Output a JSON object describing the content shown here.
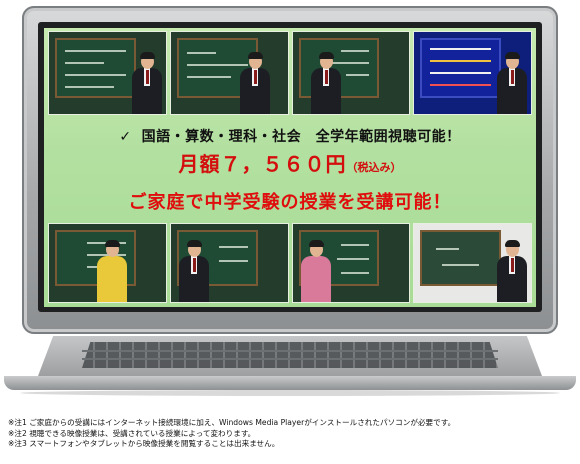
{
  "headline": {
    "check_mark": "✓",
    "subjects_line": "国語・算数・理科・社会　全学年範囲視聴可能！",
    "price": "月額７，５６０円",
    "tax_note": "（税込み）",
    "tagline": "ご家庭で中学受験の授業を受講可能！"
  },
  "thumbnails_top": [
    {
      "name": "lesson-thumb-math-grid",
      "style": "green"
    },
    {
      "name": "lesson-thumb-science-diagram",
      "style": "green"
    },
    {
      "name": "lesson-thumb-japanese-board",
      "style": "green"
    },
    {
      "name": "lesson-thumb-english-blue-slide",
      "style": "blue"
    }
  ],
  "thumbnails_bottom": [
    {
      "name": "lesson-thumb-geometry",
      "style": "green"
    },
    {
      "name": "lesson-thumb-social-board",
      "style": "green"
    },
    {
      "name": "lesson-thumb-equation",
      "style": "green"
    },
    {
      "name": "lesson-thumb-venn-diagram",
      "style": "white"
    }
  ],
  "notes": [
    "※注1  ご家庭からの受講にはインターネット接続環境に加え、Windows Media Playerがインストールされたパソコンが必要です。",
    "※注2  視聴できる映像授業は、受講されている授業によって変わります。",
    "※注3  スマートフォンやタブレットから映像授業を閲覧することは出来ません。"
  ],
  "colors": {
    "accent_red": "#e00d0d",
    "screen_green": "#b2e0a0",
    "laptop_gray": "#a4a6a8"
  }
}
